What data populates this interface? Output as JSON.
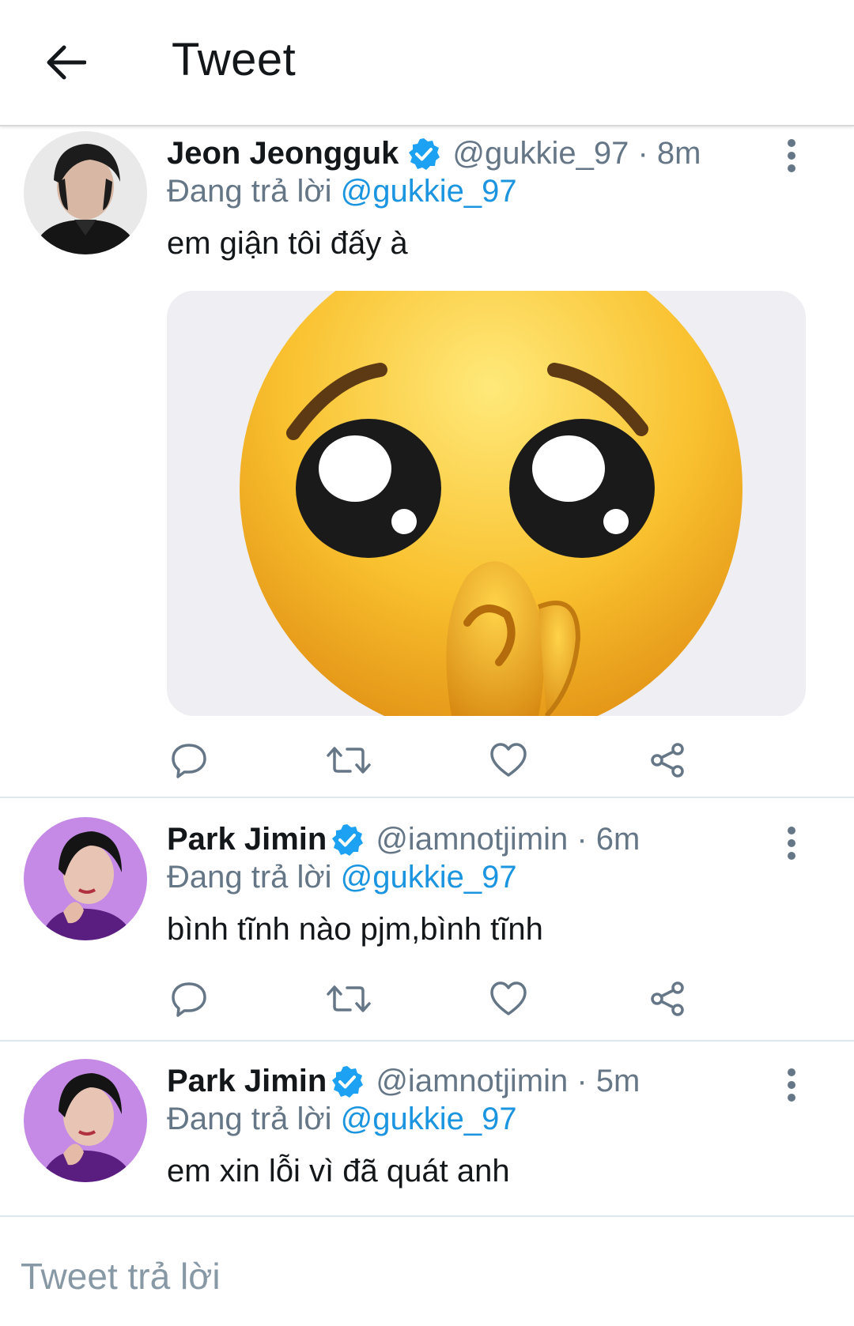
{
  "header": {
    "title": "Tweet"
  },
  "tweets": [
    {
      "name": "Jeon Jeongguk",
      "handle": "@gukkie_97 · 8m",
      "replying_prefix": "Đang trả lời",
      "replying_to": "@gukkie_97",
      "text": "em giận tôi đấy à"
    },
    {
      "name": "Park Jimin",
      "handle": "@iamnotjimin · 6m",
      "replying_prefix": "Đang trả lời",
      "replying_to": "@gukkie_97",
      "text": "bình tĩnh nào pjm,bình tĩnh"
    },
    {
      "name": "Park Jimin",
      "handle": "@iamnotjimin · 5m",
      "replying_prefix": "Đang trả lời",
      "replying_to": "@gukkie_97",
      "text": "em xin lỗi vì đã quát anh"
    }
  ],
  "compose": {
    "placeholder": "Tweet trả lời"
  },
  "colors": {
    "accent": "#1da1f2",
    "mention": "#1b95e0",
    "secondary": "#657786"
  },
  "icons": [
    "back-arrow-icon",
    "verified-badge-icon",
    "more-vertical-icon",
    "reply-icon",
    "retweet-icon",
    "like-icon",
    "share-icon"
  ]
}
